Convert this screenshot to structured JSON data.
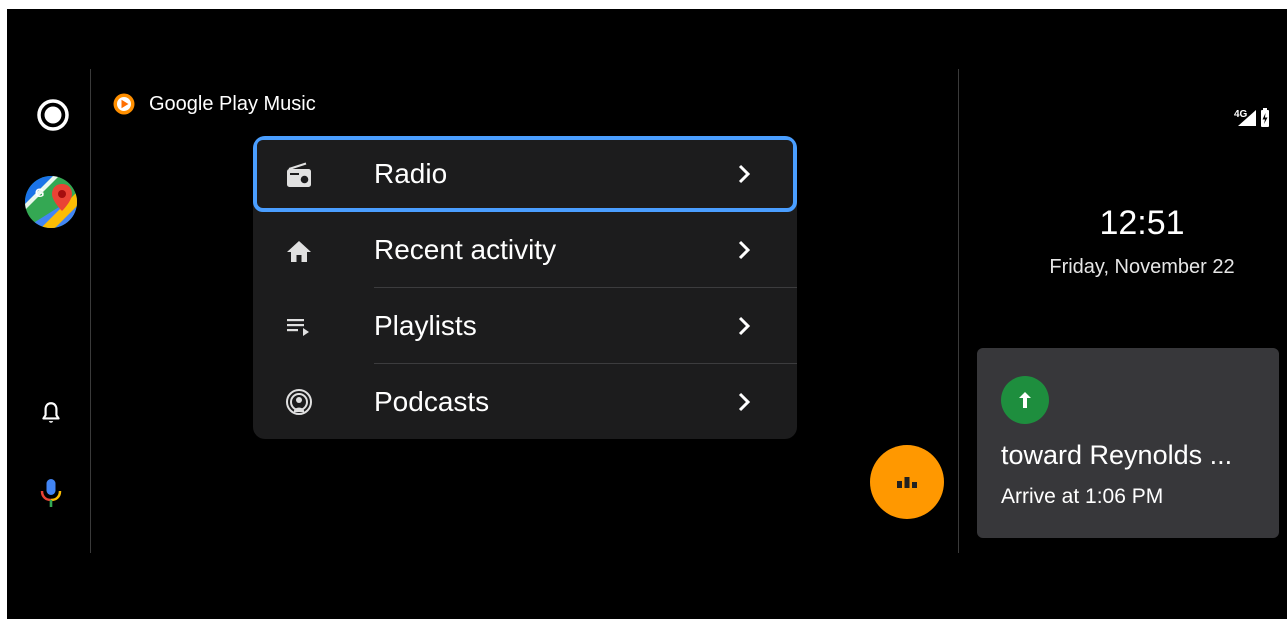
{
  "app": {
    "title": "Google Play Music"
  },
  "rail": {
    "home_icon": "home-circle-icon",
    "maps_icon": "google-maps-icon",
    "notifications_icon": "bell-icon",
    "voice_icon": "microphone-icon"
  },
  "menu": {
    "items": [
      {
        "label": "Radio",
        "icon": "radio-icon",
        "focused": true
      },
      {
        "label": "Recent activity",
        "icon": "home-icon",
        "focused": false
      },
      {
        "label": "Playlists",
        "icon": "playlist-icon",
        "focused": false
      },
      {
        "label": "Podcasts",
        "icon": "podcast-icon",
        "focused": false
      }
    ]
  },
  "status": {
    "network": "4G",
    "signal_icon": "signal-icon",
    "battery_icon": "battery-charging-icon"
  },
  "clock": {
    "time": "12:51",
    "date": "Friday, November 22"
  },
  "navigation": {
    "street": "toward Reynolds ...",
    "eta": "Arrive at 1:06 PM",
    "direction_icon": "arrow-up-icon"
  },
  "colors": {
    "focus": "#4a9eff",
    "fab": "#ff9800",
    "nav_green": "#1e8e3e",
    "card": "#37373a",
    "menu_bg": "#1c1c1d"
  }
}
